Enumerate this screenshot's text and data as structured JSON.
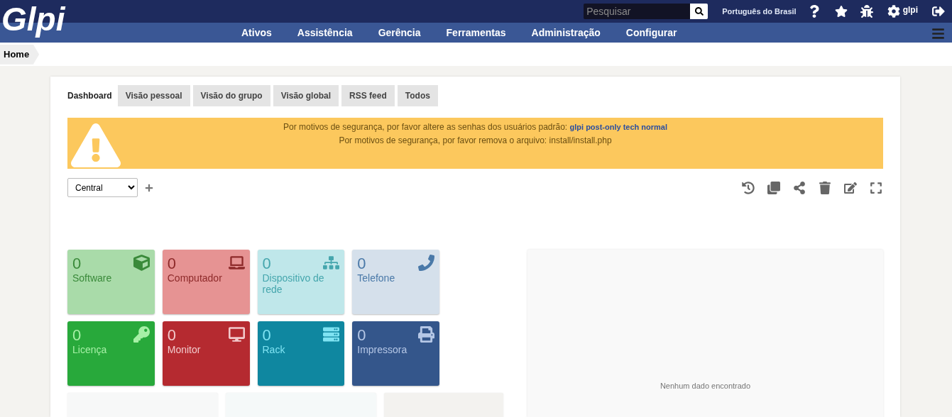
{
  "header": {
    "logo": "Glpi",
    "search": {
      "placeholder": "Pesquisar"
    },
    "language": "Português do Brasil",
    "user": "glpi"
  },
  "menu": [
    "Ativos",
    "Assistência",
    "Gerência",
    "Ferramentas",
    "Administração",
    "Configurar"
  ],
  "breadcrumb": "Home",
  "tabs": [
    {
      "label": "Dashboard",
      "selected": true
    },
    {
      "label": "Visão pessoal",
      "selected": false
    },
    {
      "label": "Visão do grupo",
      "selected": false
    },
    {
      "label": "Visão global",
      "selected": false
    },
    {
      "label": "RSS feed",
      "selected": false
    },
    {
      "label": "Todos",
      "selected": false
    }
  ],
  "warnings": [
    {
      "text": "Por motivos de segurança, por favor altere as senhas dos usuários padrão:",
      "link": "glpi post-only tech normal"
    },
    {
      "text": "Por motivos de segurança, por favor remova o arquivo: install/install.php"
    }
  ],
  "dashboard_select": {
    "value": "Central"
  },
  "cards": [
    {
      "count": "0",
      "label": "Software",
      "color": "#a9dba9"
    },
    {
      "count": "0",
      "label": "Computador",
      "color": "#e69393"
    },
    {
      "count": "0",
      "label": "Dispositivo de rede",
      "color": "#bfe7ea"
    },
    {
      "count": "0",
      "label": "Telefone",
      "color": "#d5e0eb"
    },
    {
      "count": "0",
      "label": "Licença",
      "color": "#28a93b"
    },
    {
      "count": "0",
      "label": "Monitor",
      "color": "#b52a30"
    },
    {
      "count": "0",
      "label": "Rack",
      "color": "#0f87a0"
    },
    {
      "count": "0",
      "label": "Impressora",
      "color": "#34568b"
    }
  ],
  "empty_panel": {
    "message": "Nenhum dado encontrado"
  }
}
